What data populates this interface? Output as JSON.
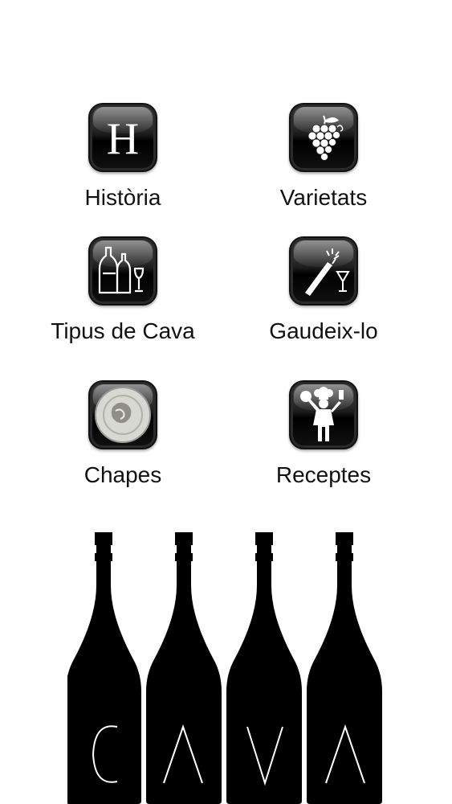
{
  "menu": {
    "items": [
      {
        "key": "historia",
        "label": "Història",
        "icon": "letter-h-icon"
      },
      {
        "key": "varietats",
        "label": "Varietats",
        "icon": "grapes-icon"
      },
      {
        "key": "tipus",
        "label": "Tipus de Cava",
        "icon": "bottles-glasses-icon"
      },
      {
        "key": "gaudeix",
        "label": "Gaudeix-lo",
        "icon": "pouring-bottle-icon"
      },
      {
        "key": "chapes",
        "label": "Chapes",
        "icon": "cava-cap-icon"
      },
      {
        "key": "receptes",
        "label": "Receptes",
        "icon": "chef-icon"
      }
    ]
  },
  "logo": {
    "letters": "CAVA",
    "color": "#000000"
  }
}
